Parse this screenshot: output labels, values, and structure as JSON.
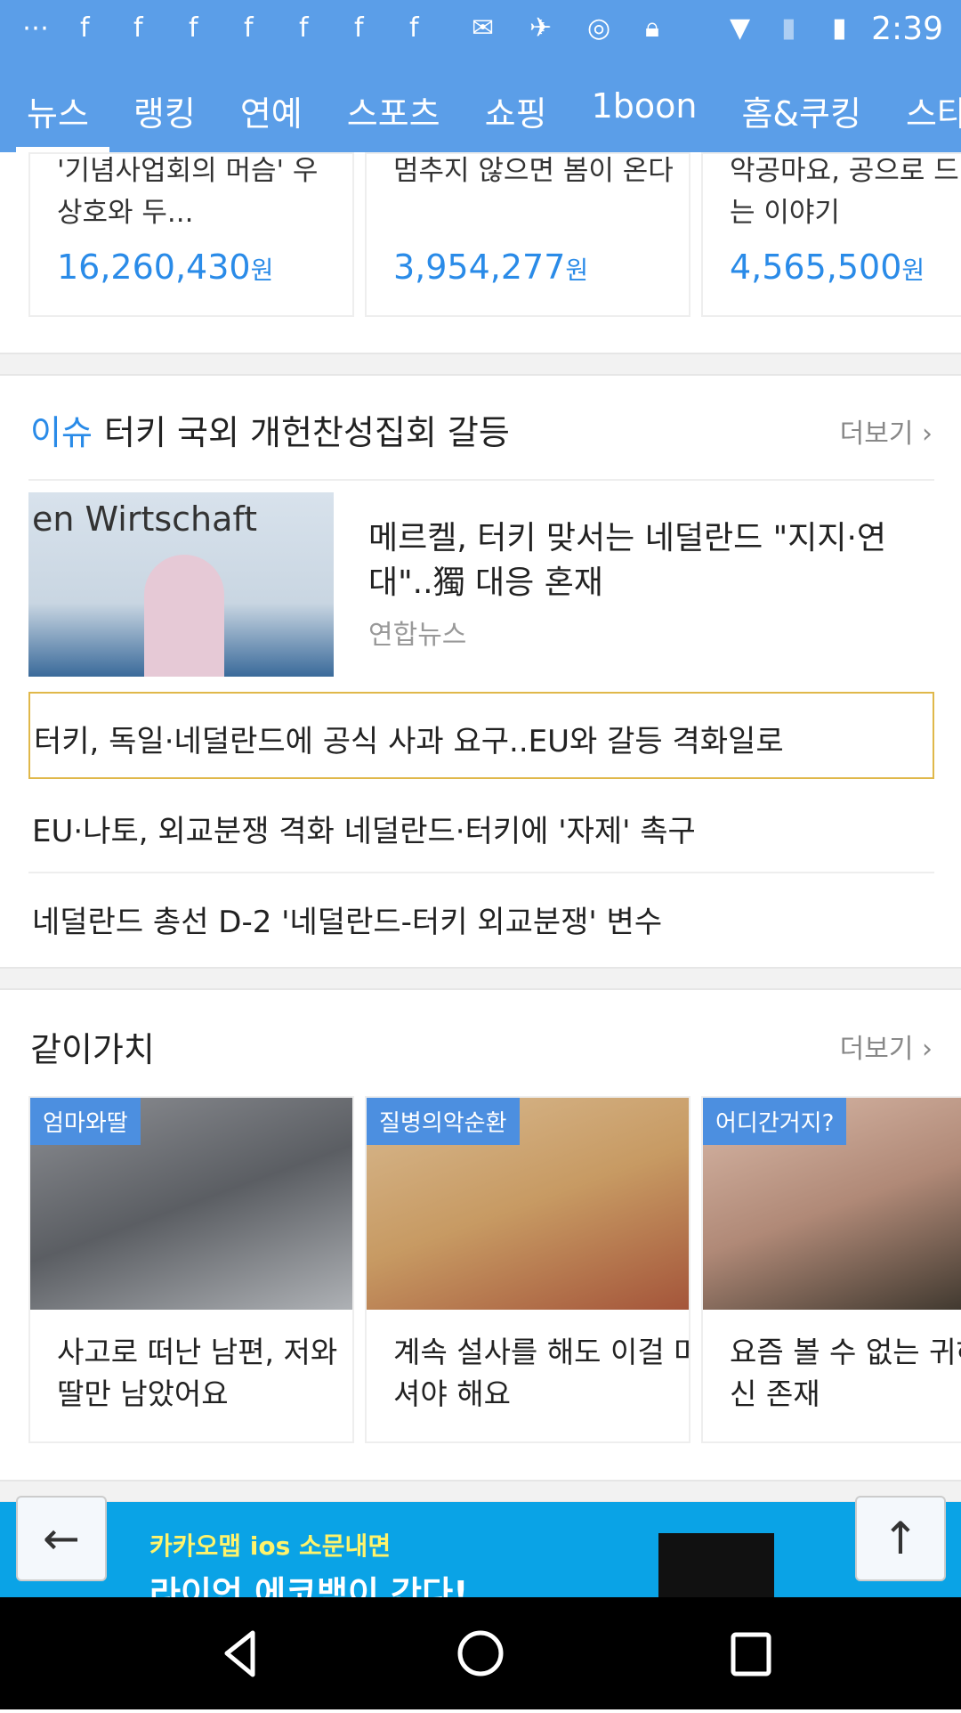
{
  "status": {
    "time": "2:39",
    "icons": [
      "more-icon",
      "facebook-icon",
      "facebook-icon",
      "facebook-icon",
      "facebook-icon",
      "facebook-icon",
      "facebook-icon",
      "facebook-icon",
      "mail-icon",
      "fake-gps-icon",
      "sync-icon",
      "lock-icon",
      "wifi-icon",
      "no-sim-icon",
      "battery-charging-icon"
    ]
  },
  "tabs": [
    "뉴스",
    "랭킹",
    "연예",
    "스포츠",
    "쇼핑",
    "1boon",
    "홈&쿠킹",
    "스타"
  ],
  "top_cards": [
    {
      "title": "'기념사업회의 머슴' 우상호와 두...",
      "amount": "16,260,430",
      "unit": "원"
    },
    {
      "title": "멈추지 않으면 봄이 온다",
      "amount": "3,954,277",
      "unit": "원"
    },
    {
      "title": "악공마요, 공으로 드는 이야기",
      "amount": "4,565,500",
      "unit": "원"
    }
  ],
  "issue": {
    "tag": "이슈",
    "title": "터키 국외 개헌찬성집회 갈등",
    "more": "더보기",
    "main_headline": "메르켈, 터키 맞서는 네덜란드 \"지지·연대\"..獨 대응 혼재",
    "source": "연합뉴스",
    "image_caption": "en Wirtschaft",
    "items": [
      "터키, 독일·네덜란드에 공식 사과 요구..EU와 갈등 격화일로",
      "EU·나토, 외교분쟁 격화 네덜란드·터키에 '자제' 촉구",
      "네덜란드 총선 D-2 '네덜란드-터키 외교분쟁' 변수"
    ]
  },
  "together": {
    "title": "같이가치",
    "more": "더보기",
    "cards": [
      {
        "badge": "엄마와딸",
        "title": "사고로 떠난 남편, 저와 딸만 남았어요"
      },
      {
        "badge": "질병의악순환",
        "title": "계속 설사를 해도 이걸 마셔야 해요"
      },
      {
        "badge": "어디간거지?",
        "title": "요즘 볼 수 없는 귀하신 존재"
      }
    ]
  },
  "banner": {
    "line1": "카카오맵 ios 소문내면",
    "line2": "라이언 에코백이 간다!"
  },
  "accent": "#5b9ee8"
}
